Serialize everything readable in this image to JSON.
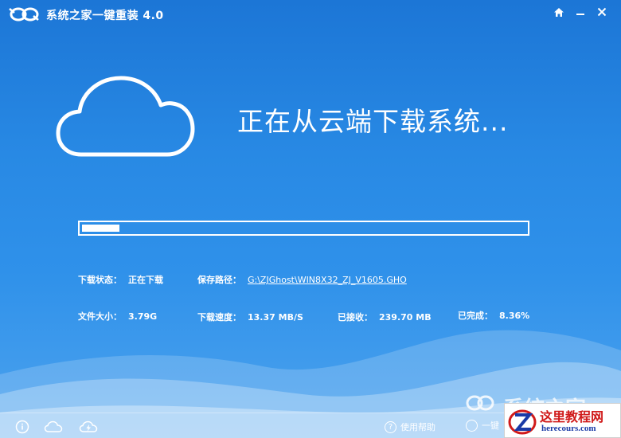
{
  "window": {
    "title": "系统之家一键重装  4.0",
    "home_icon": "home-icon",
    "minimize_icon": "minimize-icon",
    "close_icon": "close-icon"
  },
  "main": {
    "headline": "正在从云端下载系统...",
    "progress_fraction": 0.0836
  },
  "info": {
    "status_label": "下载状态：",
    "status_value": "正在下载",
    "path_label": "保存路径：",
    "path_value": "G:\\ZJGhost\\WIN8X32_ZJ_V1605.GHO",
    "size_label": "文件大小：",
    "size_value": "3.79G",
    "speed_label": "下载速度：",
    "speed_value": "13.37 MB/S",
    "received_label": "已接收：",
    "received_value": "239.70 MB",
    "completed_label": "已完成：",
    "completed_value": "8.36%"
  },
  "footer": {
    "help_label": "使用帮助",
    "brand_text": "系统之家",
    "restore_label": "一键"
  },
  "watermark": {
    "title": "这里教程网",
    "url": "herecours.com"
  },
  "colors": {
    "background_top": "#1c76d6",
    "background_bottom": "#4da3ee",
    "accent": "#ffffff",
    "watermark_red": "#d01a1a",
    "watermark_blue": "#1a3aa6"
  }
}
